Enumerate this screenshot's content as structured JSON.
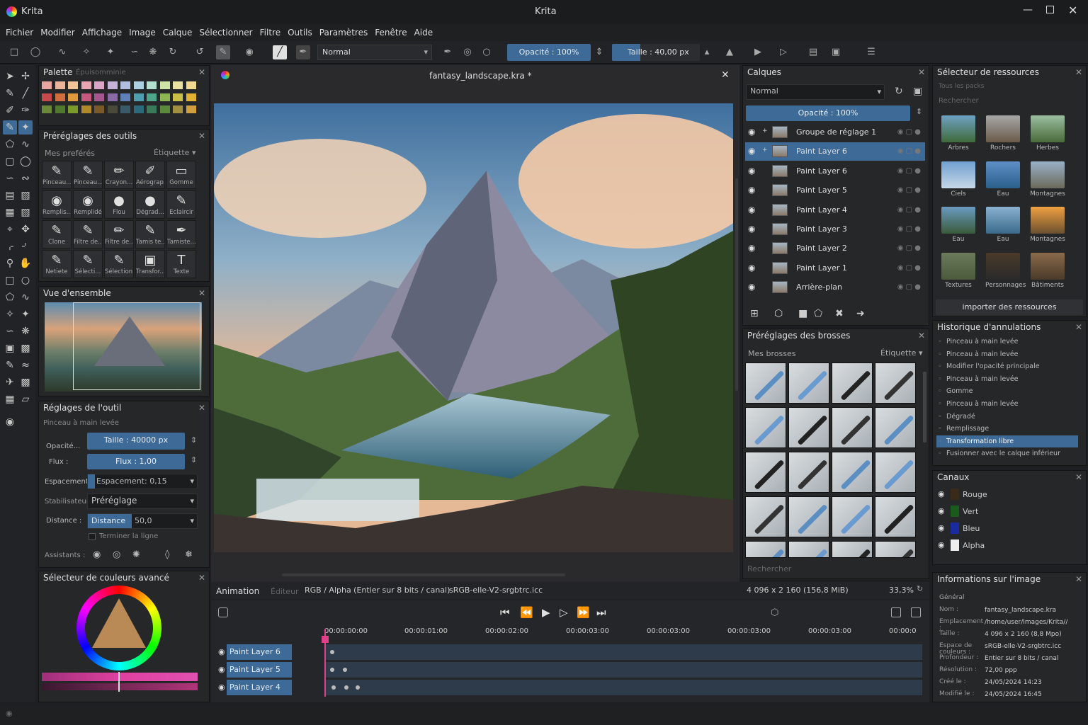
{
  "window": {
    "title": "Krita",
    "app_logo_alt": "krita-logo"
  },
  "menu": [
    "Fichier",
    "Modifier",
    "Affichage",
    "Image",
    "Calque",
    "Sélectionner",
    "Filtre",
    "Outils",
    "Paramètres",
    "Fenêtre",
    "Aide"
  ],
  "toolbar": {
    "blend_mode": "Normal",
    "opacity": "Opacité : 100%",
    "size": "Taille : 40,00 px"
  },
  "palette": {
    "title": "Palette",
    "tab2": "Épuisomminie"
  },
  "tool_presets": {
    "title": "Préréglages des outils",
    "filter": "Mes preférés",
    "tag": "Étiquette",
    "items": [
      "Pinceau...",
      "Pinceau...",
      "Crayon...",
      "Aérograp...",
      "Gomme",
      "Remplis...",
      "Remplidé",
      "Flou",
      "Dégrad...",
      "Éclaircir",
      "Clone",
      "Filtre de...",
      "Filtre de...",
      "Tamis te...",
      "Tamiste...",
      "Netiete",
      "Sélecti...",
      "Sélection...",
      "Transfor...",
      "Texte"
    ]
  },
  "overview": {
    "title": "Vue d'ensemble"
  },
  "tool_settings": {
    "title": "Réglages de l'outil",
    "subtitle": "Pinceau à main levée",
    "opacity_label": "Opacité...",
    "opacity_value": "Taille : 40000 px",
    "flow_label": "Flux :",
    "flow_value": "Flux : 1,00",
    "spacing_label": "Espacement :",
    "spacing_value": "Espacement: 0,15",
    "stabilizer_label": "Stabilisateur",
    "stabilizer_value": "Préréglage",
    "distance_label": "Distance :",
    "distance_btn": "Distance",
    "distance_value": "50,0",
    "finish_line": "Terminer la ligne",
    "assistants_label": "Assistants :"
  },
  "color_selector": {
    "title": "Sélecteur de couleurs avancé"
  },
  "canvas": {
    "doc_title": "fantasy_landscape.kra *"
  },
  "layers": {
    "title": "Calques",
    "blend": "Normal",
    "opacity": "Opacité : 100%",
    "rows": [
      "Groupe de réglage 1",
      "Paint Layer 6",
      "Paint Layer 6",
      "Paint Layer 5",
      "Paint Layer 4",
      "Paint Layer 3",
      "Paint Layer 2",
      "Paint Layer 1",
      "Arrière-plan"
    ]
  },
  "brush_presets": {
    "title": "Préréglages des brosses",
    "filter": "Mes brosses",
    "tag": "Étiquette",
    "search": "Rechercher"
  },
  "resources": {
    "title": "Sélecteur de ressources",
    "packs": "Tous les packs",
    "search": "Rechercher",
    "items": [
      "Arbres",
      "Rochers",
      "Herbes",
      "Ciels",
      "Eau",
      "Montagnes",
      "Eau",
      "Eau",
      "Montagnes",
      "Textures",
      "Personnages",
      "Bâtiments"
    ],
    "import": "importer des ressources"
  },
  "history": {
    "title": "Historique d'annulations",
    "items": [
      "Pinceau à main levée",
      "Pinceau à main levée",
      "Modifier l'opacité principale",
      "Pinceau à main levée",
      "Gomme",
      "Pinceau à main levée",
      "Dégradé",
      "Remplissage",
      "Transformation libre",
      "Fusionner avec le calque inférieur"
    ]
  },
  "channels": {
    "title": "Canaux",
    "items": [
      "Rouge",
      "Vert",
      "Bleu",
      "Alpha"
    ]
  },
  "image_info": {
    "title": "Informations sur l'image",
    "section": "Général",
    "rows": [
      [
        "Nom :",
        "fantasy_landscape.kra"
      ],
      [
        "Emplacement :",
        "/home/user/Images/Krita//"
      ],
      [
        "Taille :",
        "4 096 x 2 160 (8,8 Mpo)"
      ],
      [
        "Espace de couleurs :",
        "sRGB-elle-V2-srgbtrc.icc"
      ],
      [
        "Profondeur :",
        "Entier sur 8 bits / canal"
      ],
      [
        "Résolution :",
        "72,00 ppp"
      ],
      [
        "Créé le :",
        "24/05/2024 14:23"
      ],
      [
        "Modifié le :",
        "24/05/2024 16:45"
      ]
    ]
  },
  "status": {
    "tab_anim": "Animation",
    "tab_editor": "Éditeur",
    "color_mode": "RGB / Alpha (Entier sur 8 bits / canal)",
    "profile": "sRGB-elle-V2-srgbtrc.icc",
    "dims": "4 096 x 2 160 (156,8 MiB)",
    "zoom": "33,3%"
  },
  "timeline": {
    "times": [
      "00:00:00:00",
      "00:00:01:00",
      "00:00:02:00",
      "00:00:03:00",
      "00:00:03:00",
      "00:00:03:00",
      "00:00:03:00",
      "00:00:0"
    ],
    "layers": [
      "Paint Layer 6",
      "Paint Layer 5",
      "Paint Layer 4"
    ]
  }
}
